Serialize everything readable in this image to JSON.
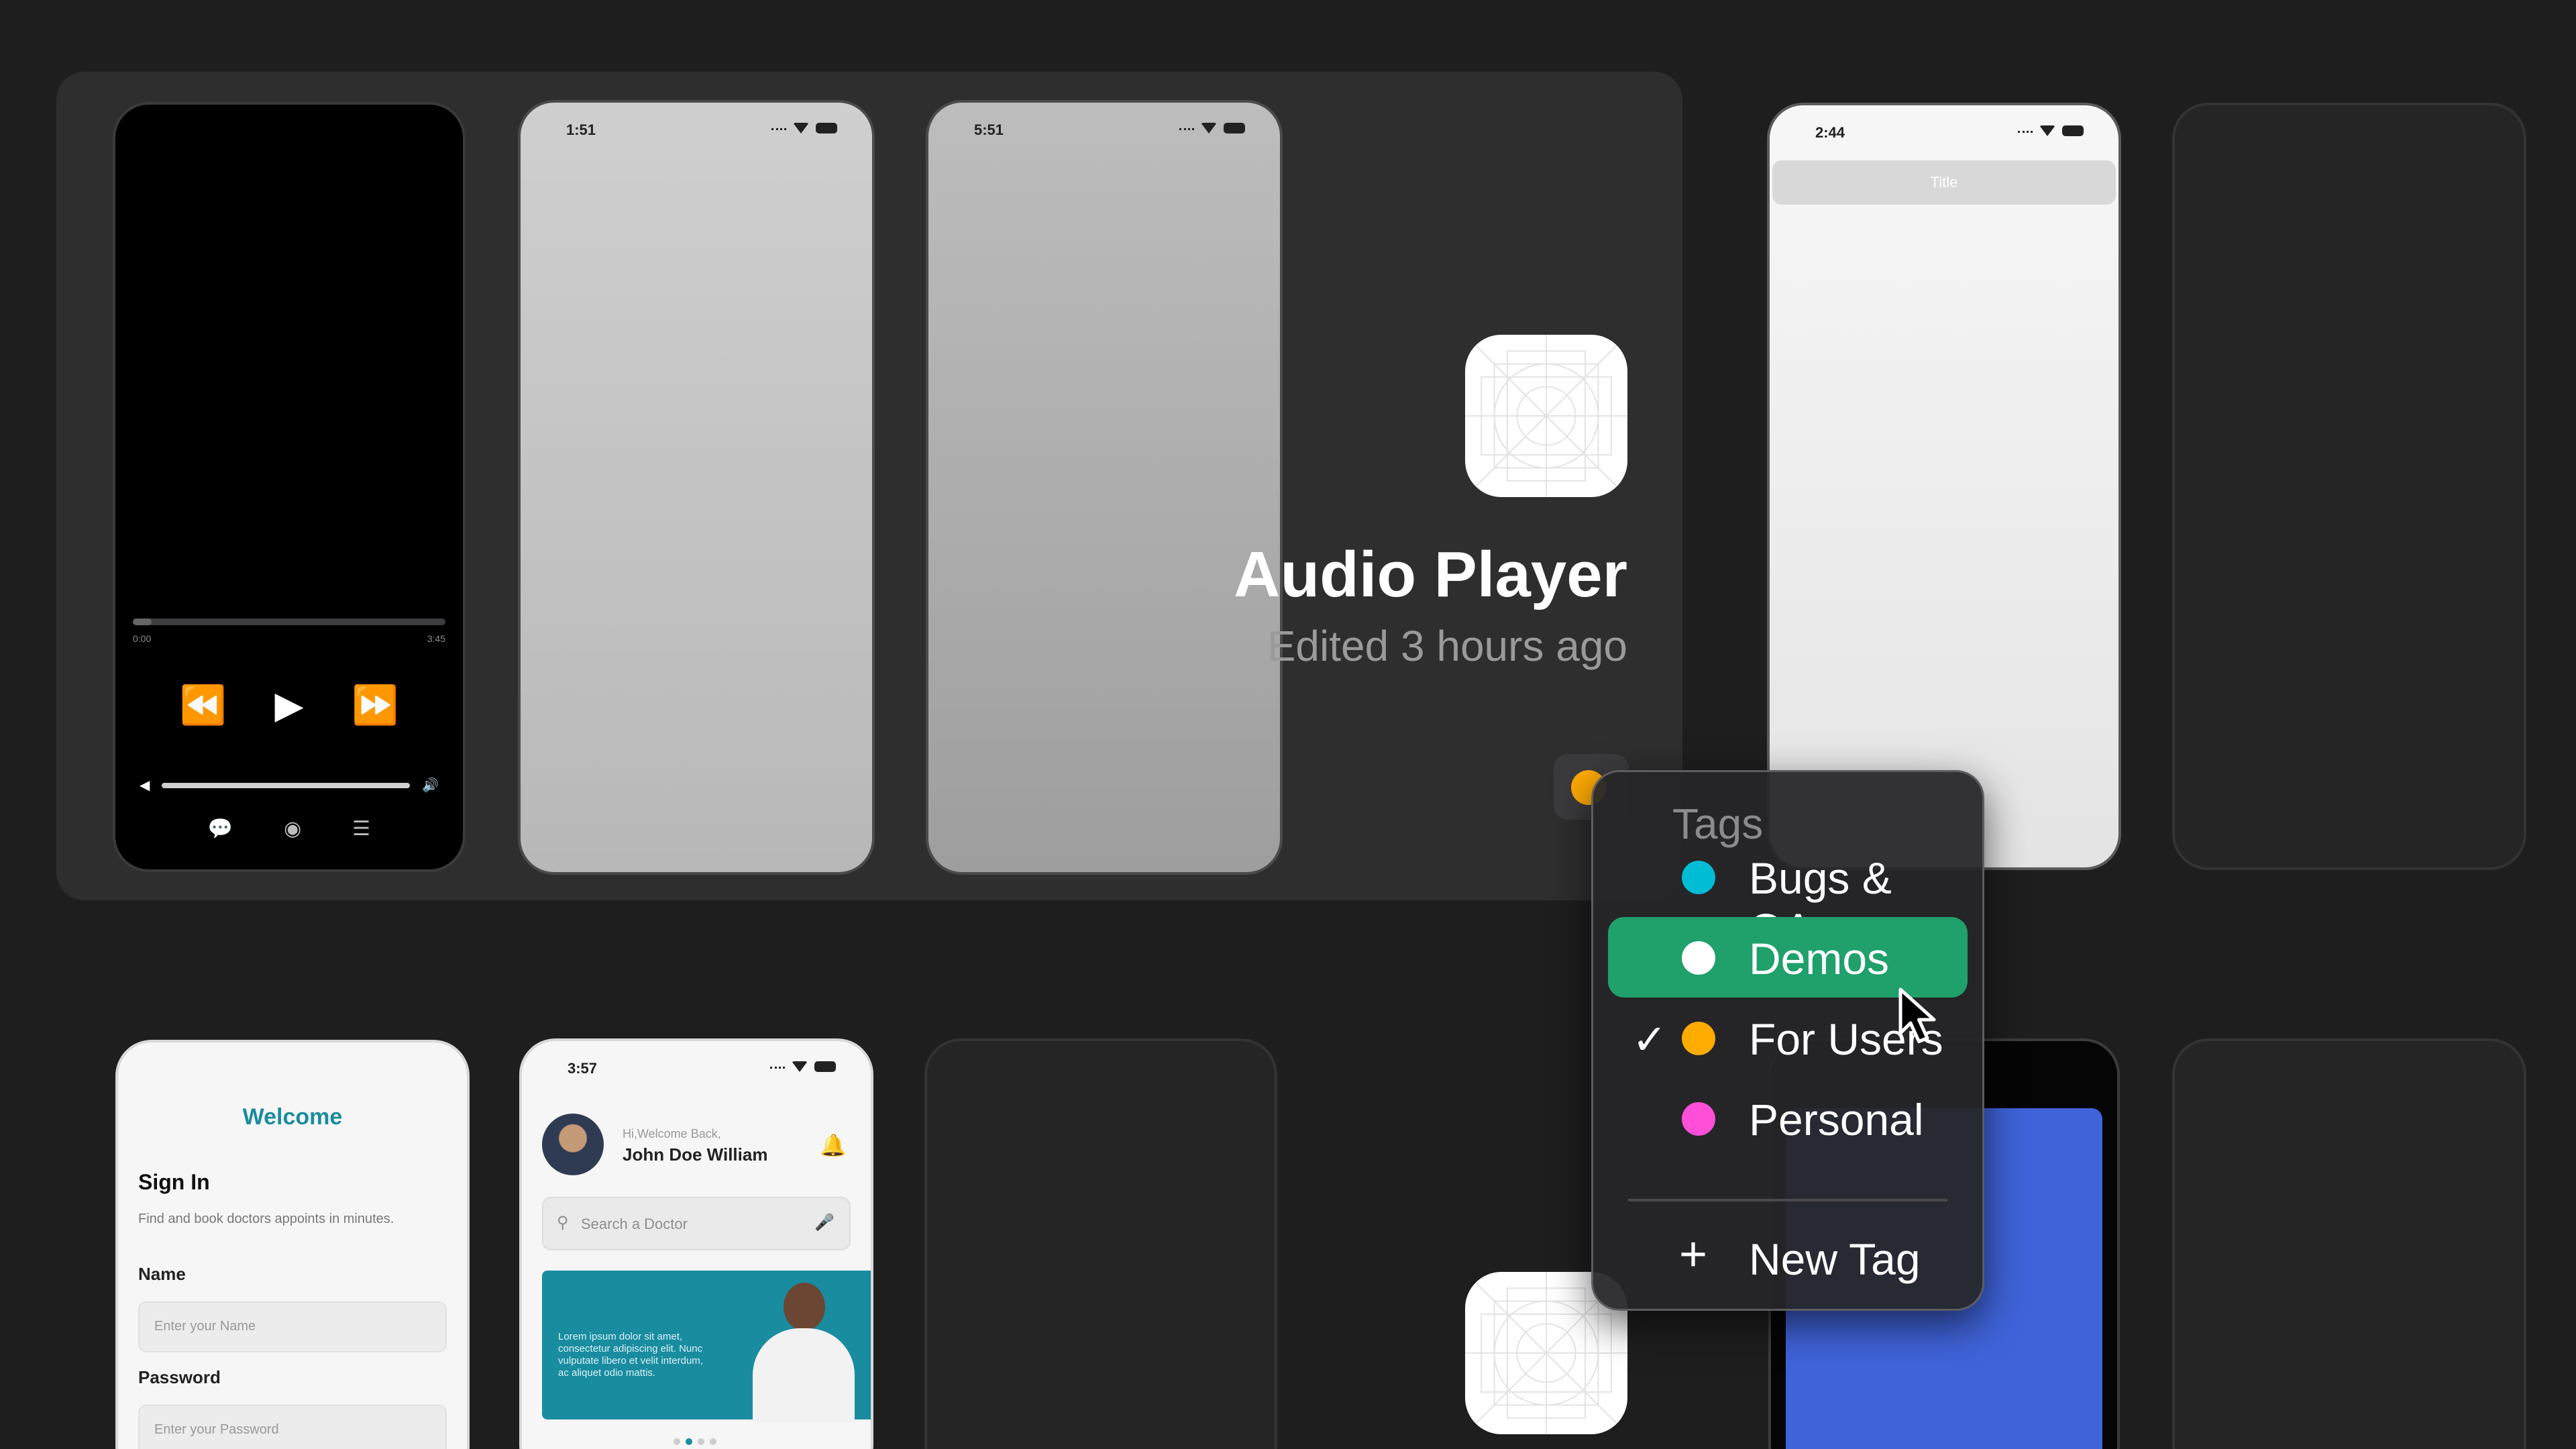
{
  "project": {
    "title": "Audio Player",
    "subtitle": "Edited 3 hours ago",
    "current_tag_color": "#ffab00"
  },
  "audio_phone": {
    "elapsed": "0:00",
    "duration": "3:45",
    "progress": 0.06,
    "controls": {
      "rewind": "rewind-icon",
      "play": "play-icon",
      "forward": "fast-forward-icon"
    },
    "bottom_icons": [
      "lyrics-icon",
      "airplay-icon",
      "queue-icon"
    ]
  },
  "screens": {
    "grey1_time": "1:51",
    "grey2_time": "5:51",
    "titled_time": "2:44",
    "titled_nav": "Title"
  },
  "signin": {
    "welcome": "Welcome",
    "heading": "Sign In",
    "desc": "Find and book doctors appoints in minutes.",
    "name_label": "Name",
    "name_placeholder": "Enter your Name",
    "password_label": "Password",
    "password_placeholder": "Enter your Password"
  },
  "doctor": {
    "time": "3:57",
    "greeting": "Hi,Welcome Back,",
    "name": "John Doe William",
    "search_placeholder": "Search a Doctor",
    "banner_text": "Lorem ipsum dolor sit amet, consectetur adipiscing elit. Nunc vulputate libero et velit interdum, ac aliquet odio mattis."
  },
  "tags_menu": {
    "header": "Tags",
    "items": [
      {
        "label": "Bugs & QA",
        "color": "#00bcd4",
        "checked": false,
        "highlighted": false
      },
      {
        "label": "Demos",
        "color": "#ffffff",
        "checked": false,
        "highlighted": true
      },
      {
        "label": "For Users",
        "color": "#ffab00",
        "checked": true,
        "highlighted": false
      },
      {
        "label": "Personal",
        "color": "#ff4fd8",
        "checked": false,
        "highlighted": false
      }
    ],
    "new_tag": "New Tag",
    "highlight_color": "#20a06b"
  }
}
